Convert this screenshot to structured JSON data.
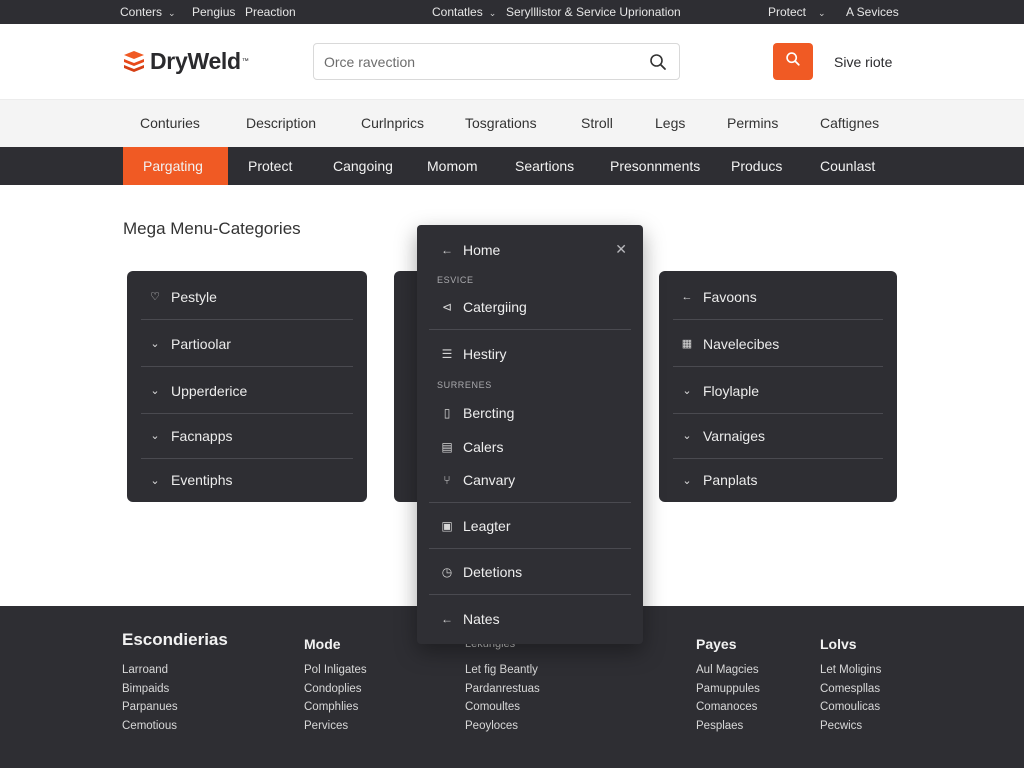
{
  "utility_bar": {
    "left_dropdown": "Conters",
    "left_link_1": "Pengius",
    "left_link_2": "Preaction",
    "mid_dropdown": "Contatles",
    "mid_text": "Serylllistor & Service Uprionation",
    "right_dropdown": "Protect",
    "right_link": "A Sevices"
  },
  "header": {
    "logo_text": "DryWeld",
    "logo_mark": "™",
    "search_placeholder": "Orce ravection",
    "link": "Sive riote"
  },
  "category_bar": [
    "Conturies",
    "Description",
    "Curlnprics",
    "Tosgrations",
    "Stroll",
    "Legs",
    "Permins",
    "Caftignes"
  ],
  "nav_bar": {
    "items": [
      "Pargating",
      "Protect",
      "Cangoing",
      "Momom",
      "Seartions",
      "Presonnments",
      "Producs",
      "Counlast"
    ],
    "active_index": 0
  },
  "content": {
    "title": "Mega Menu-Categories",
    "panel_left": [
      {
        "icon": "heart-outline-icon",
        "glyph": "♡",
        "label": "Pestyle"
      },
      {
        "icon": "chevron-down-icon",
        "glyph": "⌄",
        "label": "Partioolar"
      },
      {
        "icon": "chevron-down-icon",
        "glyph": "⌄",
        "label": "Upperderice"
      },
      {
        "icon": "chevron-down-icon",
        "glyph": "⌄",
        "label": "Facnapps"
      },
      {
        "icon": "chevron-down-icon",
        "glyph": "⌄",
        "label": "Eventiphs"
      }
    ],
    "panel_right": [
      {
        "icon": "arrow-left-icon",
        "glyph": "←",
        "label": "Favoons"
      },
      {
        "icon": "grid-icon",
        "glyph": "▦",
        "label": "Navelecibes"
      },
      {
        "icon": "chevron-down-icon",
        "glyph": "⌄",
        "label": "Floylaple"
      },
      {
        "icon": "chevron-down-icon",
        "glyph": "⌄",
        "label": "Varnaiges"
      },
      {
        "icon": "chevron-down-icon",
        "glyph": "⌄",
        "label": "Panplats"
      }
    ]
  },
  "dropdown": {
    "back_label": "Home",
    "section_1": "ESVICE",
    "section_2": "SURRENES",
    "items": [
      {
        "icon": "arrow-left-icon",
        "glyph": "←",
        "label": "Home"
      },
      {
        "icon": "share-icon",
        "glyph": "⊲",
        "label": "Catergiing"
      },
      {
        "icon": "list-icon",
        "glyph": "☰",
        "label": "Hestiry"
      },
      {
        "icon": "document-icon",
        "glyph": "▯",
        "label": "Bercting"
      },
      {
        "icon": "calendar-icon",
        "glyph": "▤",
        "label": "Calers"
      },
      {
        "icon": "branch-icon",
        "glyph": "⑂",
        "label": "Canvary"
      },
      {
        "icon": "ledger-icon",
        "glyph": "▣",
        "label": "Leagter"
      },
      {
        "icon": "clock-icon",
        "glyph": "◷",
        "label": "Detetions"
      },
      {
        "icon": "arrow-left-icon",
        "glyph": "←",
        "label": "Nates"
      }
    ]
  },
  "footer": {
    "columns": [
      {
        "heading": "Escondierias",
        "links": [
          "Larroand",
          "Bimpaids",
          "Parpanues",
          "Cemotious"
        ]
      },
      {
        "heading": "Mode",
        "links": [
          "Pol Inligates",
          "Condoplies",
          "Comphlies",
          "Pervices"
        ]
      },
      {
        "heading": "Lekungles",
        "links": [
          "Let fig Beantly",
          "Pardanrestuas",
          "Comoultes",
          "Peoyloces"
        ]
      },
      {
        "heading": "Payes",
        "links": [
          "Aul Magcies",
          "Pamuppules",
          "Comanoces",
          "Pesplaes"
        ]
      },
      {
        "heading": "Lolvs",
        "links": [
          "Let Moligins",
          "Comespllas",
          "Comoulicas",
          "Pecwics"
        ]
      }
    ]
  },
  "colors": {
    "accent": "#f05a24",
    "dark": "#2e2e33",
    "light_bar": "#f4f4f4"
  }
}
